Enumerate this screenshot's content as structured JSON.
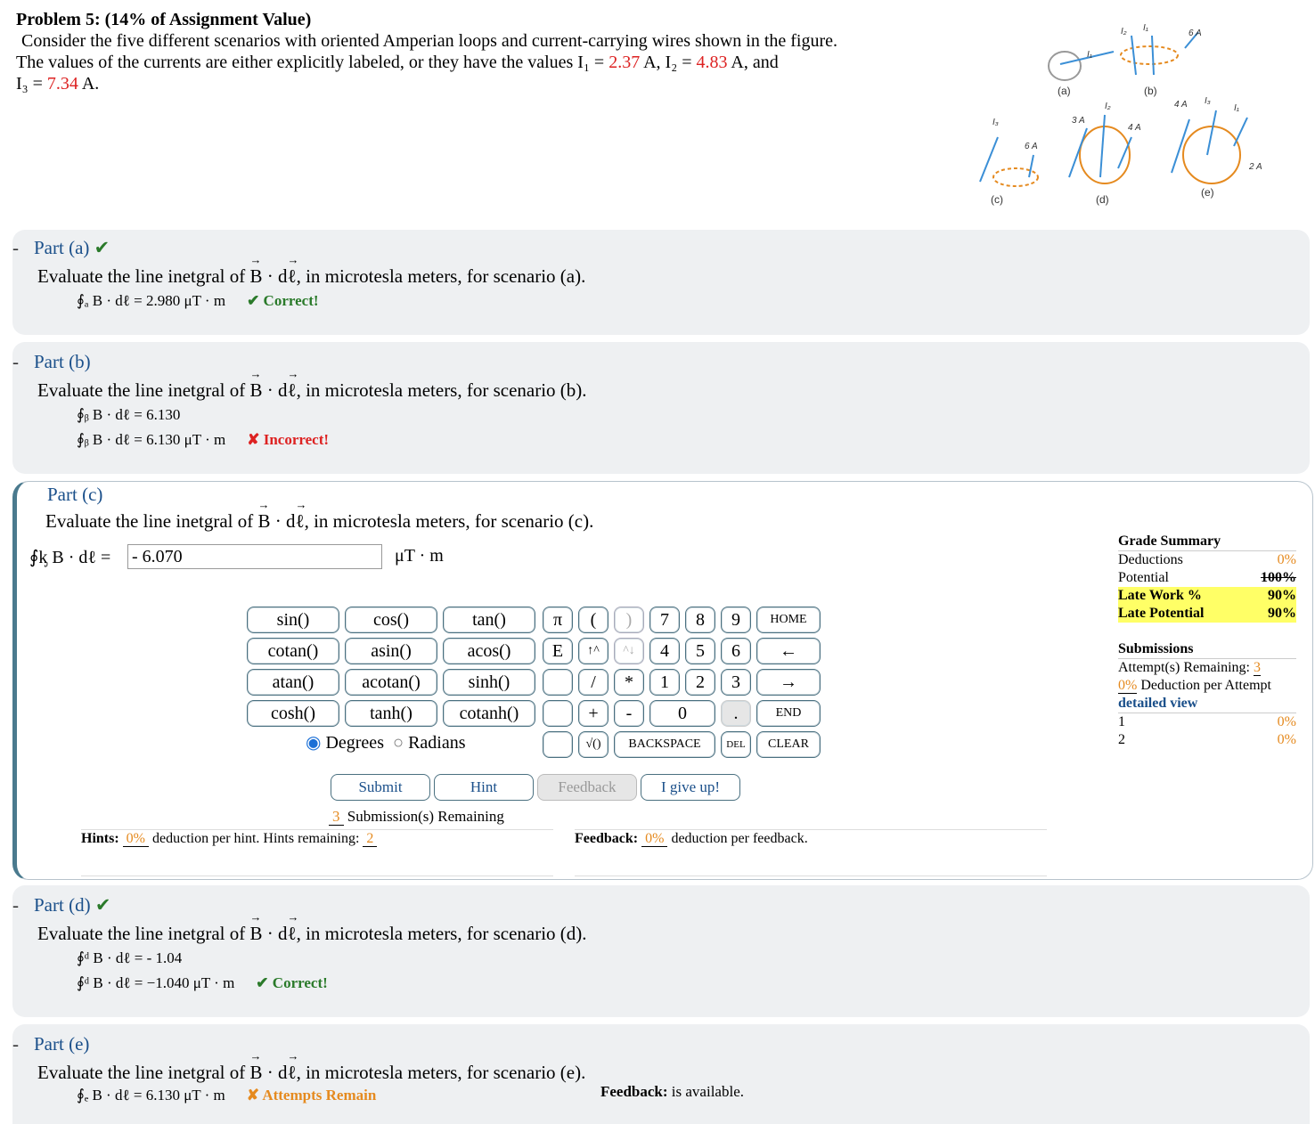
{
  "header": {
    "title": "Problem 5: (14% of Assignment Value)",
    "line1": "Consider the five different scenarios with oriented Amperian loops and current-carrying wires shown in the figure.",
    "line2_pre": "The values of the currents are either explicitly labeled, or they have the values I₁ = ",
    "I1": "2.37",
    "line2_mid1": " A, I₂ = ",
    "I2": "4.83",
    "line2_mid2": " A, and",
    "line3_pre": "I₃ = ",
    "I3": "7.34",
    "line3_post": " A."
  },
  "figure": {
    "labels": [
      "(a)",
      "(b)",
      "(c)",
      "(d)",
      "(e)"
    ],
    "currents": [
      "I₁",
      "I₂",
      "I₁",
      "6 A",
      "I₃",
      "6 A",
      "3 A",
      "I₂",
      "4 A",
      "4 A",
      "I₃",
      "I₁",
      "2 A"
    ]
  },
  "parts": {
    "a": {
      "heading": "Part (a)",
      "check": "✔",
      "prompt_pre": "Evaluate the line inetgral of ",
      "prompt_post": ", in microtesla meters, for scenario (a).",
      "answer": "∮ₐ B · dℓ = 2.980 μT · m",
      "status": "✔ Correct!"
    },
    "b": {
      "heading": "Part (b)",
      "prompt_post": ", in microtesla meters, for scenario (b).",
      "entered": "∮ᵦ B · dℓ = 6.130",
      "answer": "∮ᵦ B · dℓ = 6.130 μT · m",
      "status": "✘ Incorrect!"
    },
    "c": {
      "heading": "Part (c)",
      "prompt_post": ", in microtesla meters, for scenario (c).",
      "lhs": "∮ᶄ B · dℓ =",
      "input_value": "- 6.070",
      "unit": "μT · m",
      "degrees": "Degrees",
      "radians": "Radians",
      "submit": "Submit",
      "hint": "Hint",
      "feedback": "Feedback",
      "give_up": "I give up!",
      "subs_count": "3",
      "subs_label": " Submission(s) Remaining",
      "hints_label": "Hints:",
      "hints_pct": "0%",
      "hints_text": " deduction per hint. Hints remaining: ",
      "hints_remaining": "2",
      "feedback_label": "Feedback:",
      "feedback_pct": "0%",
      "feedback_text": " deduction per feedback."
    },
    "d": {
      "heading": "Part (d)",
      "check": "✔",
      "prompt_post": ", in microtesla meters, for scenario (d).",
      "entered": "∮ᵈ B · dℓ = - 1.04",
      "answer": "∮ᵈ B · dℓ = −1.040 μT · m",
      "status": "✔ Correct!"
    },
    "e": {
      "heading": "Part (e)",
      "prompt_post": ", in microtesla meters, for scenario (e).",
      "answer": "∮ₑ B · dℓ = 6.130 μT · m",
      "status": "✘ Attempts Remain",
      "fb_label": "Feedback:",
      "fb_text": " is available."
    }
  },
  "keypad": {
    "func": [
      "sin()",
      "cos()",
      "tan()",
      "cotan()",
      "asin()",
      "acos()",
      "atan()",
      "acotan()",
      "sinh()",
      "cosh()",
      "tanh()",
      "cotanh()"
    ],
    "keys": [
      "π",
      "(",
      ")",
      "7",
      "8",
      "9",
      "HOME",
      "E",
      "↑^",
      "^↓",
      "4",
      "5",
      "6",
      "←",
      "",
      "/",
      "*",
      "1",
      "2",
      "3",
      "→",
      "",
      "+",
      "-",
      "0",
      ".",
      "END",
      "",
      "√()",
      "BACKSPACE",
      "DEL",
      "CLEAR"
    ]
  },
  "grade": {
    "title": "Grade Summary",
    "deductions_label": "Deductions",
    "deductions": "0%",
    "potential_label": "Potential",
    "potential": "100%",
    "late_work_label": "Late Work %",
    "late_work": "90%",
    "late_potential_label": "Late Potential",
    "late_potential": "90%",
    "subs_title": "Submissions",
    "attempts_label": "Attempt(s) Remaining: ",
    "attempts": "3",
    "deduct_pct": "0%",
    "deduct_label": " Deduction per Attempt",
    "detailed": "detailed view",
    "rows": [
      {
        "n": "1",
        "v": "0%"
      },
      {
        "n": "2",
        "v": "0%"
      }
    ]
  }
}
